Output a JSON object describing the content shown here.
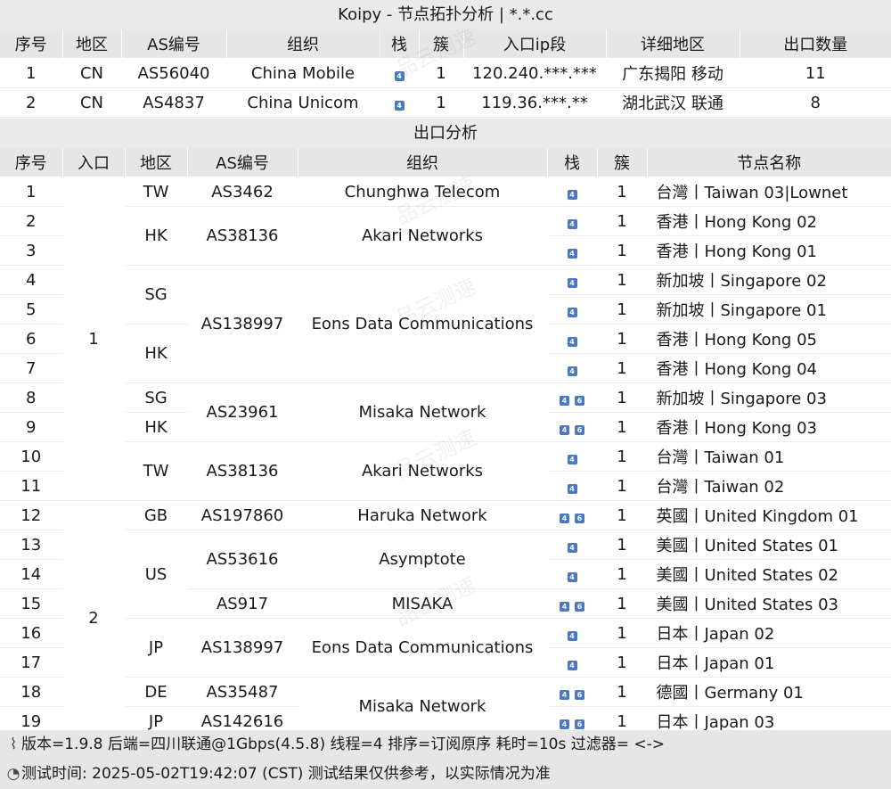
{
  "title": "Koipy - 节点拓扑分析 | *.*.cc",
  "watermark": "品云测速",
  "entry_section": {
    "headers": [
      "序号",
      "地区",
      "AS编号",
      "组织",
      "栈",
      "簇",
      "入口ip段",
      "详细地区",
      "出口数量"
    ],
    "rows": [
      {
        "idx": "1",
        "region": "CN",
        "asn": "AS56040",
        "org": "China Mobile",
        "stack": [
          "4"
        ],
        "cluster": "1",
        "ip": "120.240.***.***",
        "detail": "广东揭阳 移动",
        "count": "11"
      },
      {
        "idx": "2",
        "region": "CN",
        "asn": "AS4837",
        "org": "China Unicom",
        "stack": [
          "4"
        ],
        "cluster": "1",
        "ip": "119.36.***.**",
        "detail": "湖北武汉 联通",
        "count": "8"
      }
    ]
  },
  "exit_section": {
    "title": "出口分析",
    "headers": [
      "序号",
      "入口",
      "地区",
      "AS编号",
      "组织",
      "栈",
      "簇",
      "节点名称"
    ],
    "entries": [
      "1",
      "2"
    ],
    "regions": [
      "TW",
      "HK",
      "SG",
      "HK",
      "SG",
      "HK",
      "TW",
      "GB",
      "US",
      "JP",
      "DE",
      "JP"
    ],
    "asns": [
      "AS3462",
      "AS38136",
      "AS138997",
      "AS23961",
      "AS38136",
      "AS197860",
      "AS53616",
      "AS917",
      "AS138997",
      "AS35487",
      "AS142616"
    ],
    "orgs": [
      "Chunghwa Telecom",
      "Akari Networks",
      "Eons Data Communications",
      "Misaka Network",
      "Akari Networks",
      "Haruka Network",
      "Asymptote",
      "MISAKA",
      "Eons Data Communications",
      "Misaka Network"
    ],
    "rows": [
      {
        "idx": "1",
        "stack": [
          "4"
        ],
        "cluster": "1",
        "name": "台灣丨Taiwan 03|Lownet"
      },
      {
        "idx": "2",
        "stack": [
          "4"
        ],
        "cluster": "1",
        "name": "香港丨Hong Kong 02"
      },
      {
        "idx": "3",
        "stack": [
          "4"
        ],
        "cluster": "1",
        "name": "香港丨Hong Kong 01"
      },
      {
        "idx": "4",
        "stack": [
          "4"
        ],
        "cluster": "1",
        "name": "新加坡丨Singapore 02"
      },
      {
        "idx": "5",
        "stack": [
          "4"
        ],
        "cluster": "1",
        "name": "新加坡丨Singapore 01"
      },
      {
        "idx": "6",
        "stack": [
          "4"
        ],
        "cluster": "1",
        "name": "香港丨Hong Kong 05"
      },
      {
        "idx": "7",
        "stack": [
          "4"
        ],
        "cluster": "1",
        "name": "香港丨Hong Kong 04"
      },
      {
        "idx": "8",
        "stack": [
          "4",
          "6"
        ],
        "cluster": "1",
        "name": "新加坡丨Singapore 03"
      },
      {
        "idx": "9",
        "stack": [
          "4",
          "6"
        ],
        "cluster": "1",
        "name": "香港丨Hong Kong 03"
      },
      {
        "idx": "10",
        "stack": [
          "4"
        ],
        "cluster": "1",
        "name": "台灣丨Taiwan 01"
      },
      {
        "idx": "11",
        "stack": [
          "4"
        ],
        "cluster": "1",
        "name": "台灣丨Taiwan 02"
      },
      {
        "idx": "12",
        "stack": [
          "4",
          "6"
        ],
        "cluster": "1",
        "name": "英國丨United Kingdom 01"
      },
      {
        "idx": "13",
        "stack": [
          "4"
        ],
        "cluster": "1",
        "name": "美國丨United States 01"
      },
      {
        "idx": "14",
        "stack": [
          "4"
        ],
        "cluster": "1",
        "name": "美國丨United States 02"
      },
      {
        "idx": "15",
        "stack": [
          "4",
          "6"
        ],
        "cluster": "1",
        "name": "美國丨United States 03"
      },
      {
        "idx": "16",
        "stack": [
          "4"
        ],
        "cluster": "1",
        "name": "日本丨Japan 02"
      },
      {
        "idx": "17",
        "stack": [
          "4"
        ],
        "cluster": "1",
        "name": "日本丨Japan 01"
      },
      {
        "idx": "18",
        "stack": [
          "4",
          "6"
        ],
        "cluster": "1",
        "name": "德國丨Germany 01"
      },
      {
        "idx": "19",
        "stack": [
          "4",
          "6"
        ],
        "cluster": "1",
        "name": "日本丨Japan 03"
      }
    ]
  },
  "footer": {
    "line1": "版本=1.9.8  后端=四川联通@1Gbps(4.5.8)   线程=4  排序=订阅原序  耗时=10s    过滤器= <->",
    "line2": "测试时间: 2025-05-02T19:42:07 (CST)  测试结果仅供参考，以实际情况为准",
    "icon1": "dna-icon",
    "icon2": "clock-icon"
  },
  "colors": {
    "badge": "#4a78c2",
    "header_bg": "#e6e6e6"
  }
}
